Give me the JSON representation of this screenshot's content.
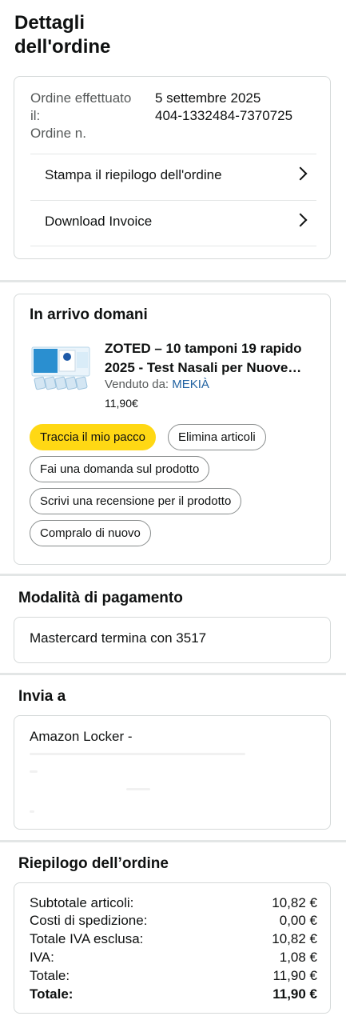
{
  "page": {
    "title": "Dettagli dell'ordine"
  },
  "order_info": {
    "date_label": "Ordine effettuato il:",
    "date_value": "5 settembre 2025",
    "number_label": "Ordine n.",
    "number_value": "404-1332484-7370725",
    "links": [
      {
        "label": "Stampa il riepilogo dell'ordine",
        "icon": "chevron-right-icon"
      },
      {
        "label": "Download Invoice",
        "icon": "chevron-right-icon"
      }
    ]
  },
  "shipment": {
    "title": "In arrivo domani",
    "product": {
      "name_line1": "ZOTED – 10 tamponi 19 rapido",
      "name_line2": "2025 - Test Nasali per Nuove…",
      "sold_by_label": "Venduto da:",
      "seller": "MEKIÀ",
      "price": "11,90€"
    },
    "actions": {
      "track": "Traccia il mio pacco",
      "delete": "Elimina articoli",
      "ask": "Fai una domanda sul prodotto",
      "review": "Scrivi una recensione per il prodotto",
      "buy_again": "Compralo di nuovo"
    },
    "colors": {
      "primary_button": "#ffd814",
      "seller_link": "#2162a1"
    }
  },
  "payment": {
    "title": "Modalità di pagamento",
    "method": "Mastercard  termina con 3517"
  },
  "ship_to": {
    "title": "Invia a",
    "name": "Amazon Locker -"
  },
  "summary": {
    "title": "Riepilogo dell’ordine",
    "rows": [
      {
        "label": "Subtotale articoli:",
        "value": "10,82 €"
      },
      {
        "label": "Costi di spedizione:",
        "value": "0,00 €"
      },
      {
        "label": "Totale IVA esclusa:",
        "value": "10,82 €"
      },
      {
        "label": "IVA:",
        "value": "1,08 €"
      },
      {
        "label": "Totale:",
        "value": "11,90 €"
      },
      {
        "label": "Totale:",
        "value": "11,90 €"
      }
    ]
  }
}
